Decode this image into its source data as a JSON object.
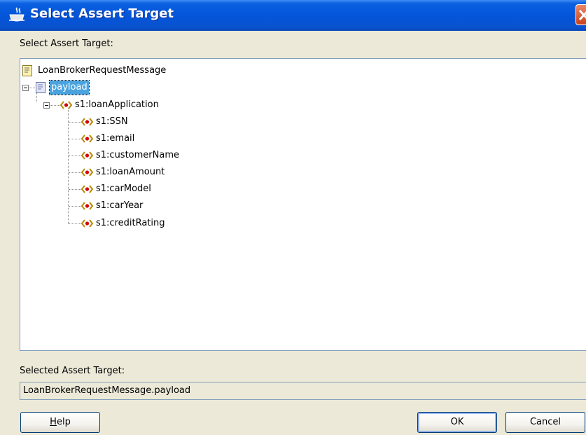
{
  "window": {
    "title": "Select Assert Target",
    "title_icon": "app-coffee-icon",
    "close_icon": "close-icon"
  },
  "tree_label": "Select Assert Target:",
  "tree": {
    "root": "LoanBrokerRequestMessage",
    "payload": "payload",
    "loan_application": "s1:loanApplication",
    "children": [
      "s1:SSN",
      "s1:email",
      "s1:customerName",
      "s1:loanAmount",
      "s1:carModel",
      "s1:carYear",
      "s1:creditRating"
    ]
  },
  "selected_label": "Selected Assert Target:",
  "selected_value": "LoanBrokerRequestMessage.payload",
  "buttons": {
    "help_mnemonic": "H",
    "help_rest": "elp",
    "ok": "OK",
    "cancel": "Cancel"
  },
  "colors": {
    "titlebar": "#0454d8",
    "selection": "#4aa3df",
    "dialog_bg": "#ece9d8"
  }
}
